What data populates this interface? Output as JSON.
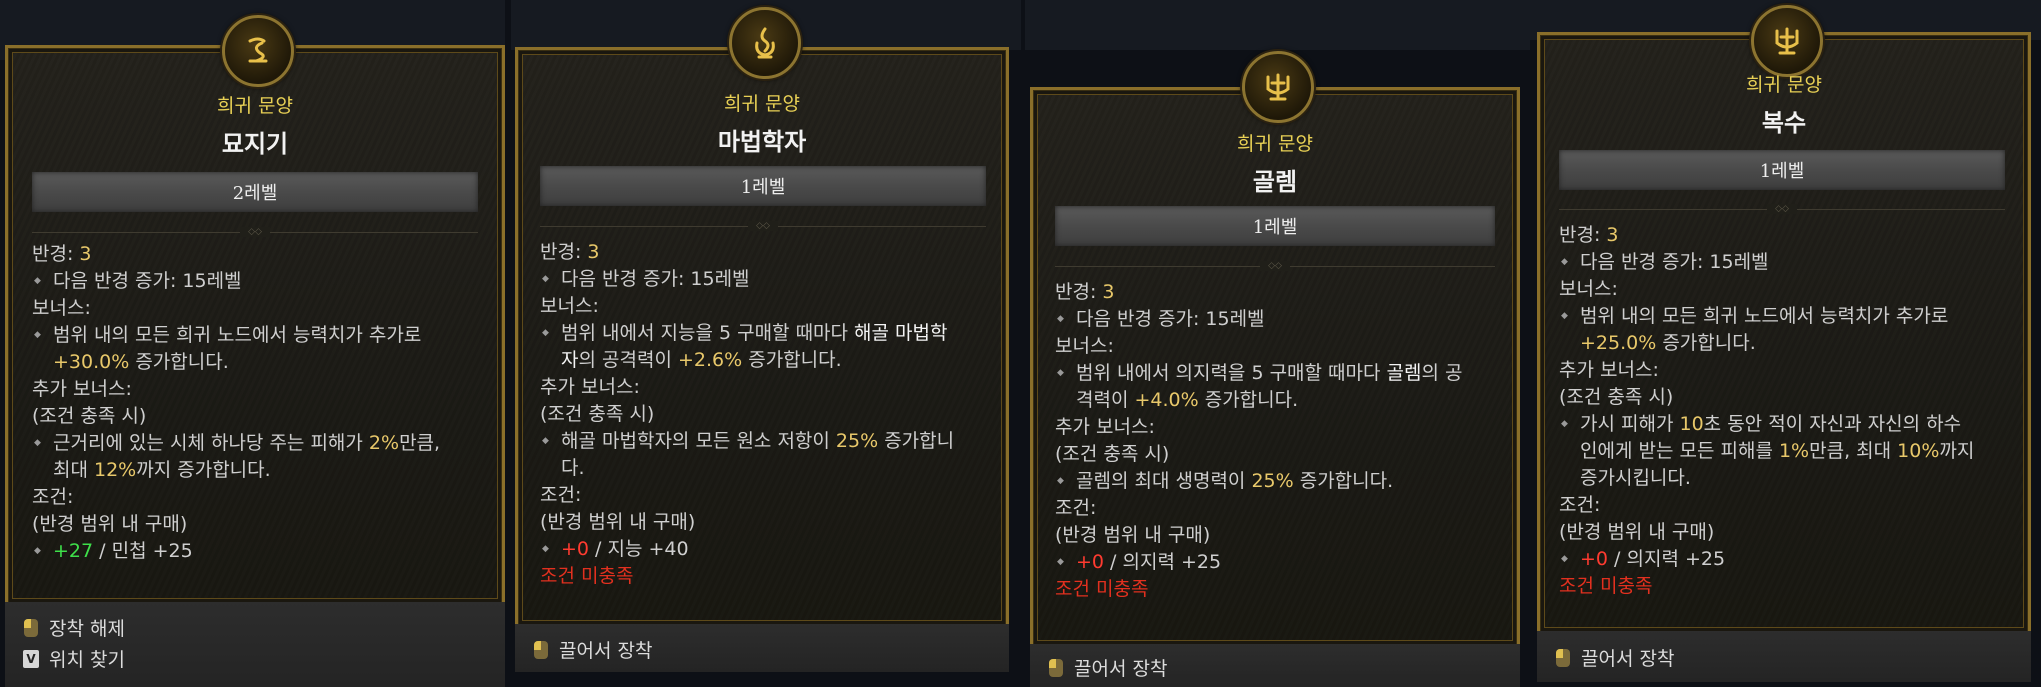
{
  "cards": [
    {
      "rarity": "희귀 문양",
      "name": "묘지기",
      "level": "2레벨",
      "radius_label": "반경:",
      "radius_value": "3",
      "next_radius": "다음 반경 증가: 15레벨",
      "bonus_label": "보너스:",
      "bonus": {
        "a": "범위 내의 모든 희귀 노드에서 능력치가 추가로",
        "b_value": "+30.0%",
        "b_rest": " 증가합니다."
      },
      "extra_label": "추가 보너스:",
      "extra_cond": "(조건 충족 시)",
      "extra": {
        "a1": "근거리에 있는 시체 하나당 주는 피해가 ",
        "a_val": "2%",
        "a2": "만큼,",
        "b1": "최대 ",
        "b_val": "12%",
        "b2": "까지 증가합니다."
      },
      "req_label": "조건:",
      "req_sub": "(반경 범위 내 구매)",
      "req": {
        "val": "+27",
        "rest": " / 민첩 +25"
      },
      "footer": [
        "장착 해제",
        "위치 찾기"
      ],
      "footer_key": "V",
      "icon": "rune-glyph-icon"
    },
    {
      "rarity": "희귀 문양",
      "name": "마법학자",
      "level": "1레벨",
      "radius_label": "반경:",
      "radius_value": "3",
      "next_radius": "다음 반경 증가: 15레벨",
      "bonus_label": "보너스:",
      "bonus": {
        "a1": "범위 내에서 지능을 5 구매할 때마다 ",
        "a_hl": "해골 마법학",
        "b_hl": "자",
        "b1": "의 공격력이 ",
        "b_val": "+2.6%",
        "b2": " 증가합니다."
      },
      "extra_label": "추가 보너스:",
      "extra_cond": "(조건 충족 시)",
      "extra": {
        "a1": "해골 마법학자의 모든 원소 저항이 ",
        "a_val": "25%",
        "a2": " 증가합니",
        "b1": "다."
      },
      "req_label": "조건:",
      "req_sub": "(반경 범위 내 구매)",
      "req": {
        "val": "+0",
        "rest": " / 지능 +40"
      },
      "unmet": "조건 미충족",
      "footer": [
        "끌어서 장착"
      ],
      "icon": "flame-glyph-icon"
    },
    {
      "rarity": "희귀 문양",
      "name": "골렘",
      "level": "1레벨",
      "radius_label": "반경:",
      "radius_value": "3",
      "next_radius": "다음 반경 증가: 15레벨",
      "bonus_label": "보너스:",
      "bonus": {
        "a1": "범위 내에서 의지력을 5 구매할 때마다 ",
        "a_hl": "골렘",
        "a2": "의 공",
        "b1": "격력이 ",
        "b_val": "+4.0%",
        "b2": " 증가합니다."
      },
      "extra_label": "추가 보너스:",
      "extra_cond": "(조건 충족 시)",
      "extra": {
        "a1": "골렘의 최대 생명력이 ",
        "a_val": "25%",
        "a2": " 증가합니다."
      },
      "req_label": "조건:",
      "req_sub": "(반경 범위 내 구매)",
      "req": {
        "val": "+0",
        "rest": " / 의지력 +25"
      },
      "unmet": "조건 미충족",
      "footer": [
        "끌어서 장착"
      ],
      "icon": "trident-glyph-icon"
    },
    {
      "rarity": "희귀 문양",
      "name": "복수",
      "level": "1레벨",
      "radius_label": "반경:",
      "radius_value": "3",
      "next_radius": "다음 반경 증가: 15레벨",
      "bonus_label": "보너스:",
      "bonus": {
        "a": "범위 내의 모든 희귀 노드에서 능력치가 추가로",
        "b_value": "+25.0%",
        "b_rest": " 증가합니다."
      },
      "extra_label": "추가 보너스:",
      "extra_cond": "(조건 충족 시)",
      "extra": {
        "a1": "가시 피해가 ",
        "a_val": "10",
        "a2": "초 동안 적이 자신과 자신의 하수",
        "b1": "인에게 받는 모든 피해를 ",
        "b_val": "1%",
        "b2": "만큼, 최대 ",
        "b_val2": "10%",
        "b3": "까지",
        "c1": "증가시킵니다."
      },
      "req_label": "조건:",
      "req_sub": "(반경 범위 내 구매)",
      "req": {
        "val": "+0",
        "rest": " / 의지력 +25"
      },
      "unmet": "조건 미충족",
      "footer": [
        "끌어서 장착"
      ],
      "icon": "trident-glyph-icon"
    }
  ]
}
